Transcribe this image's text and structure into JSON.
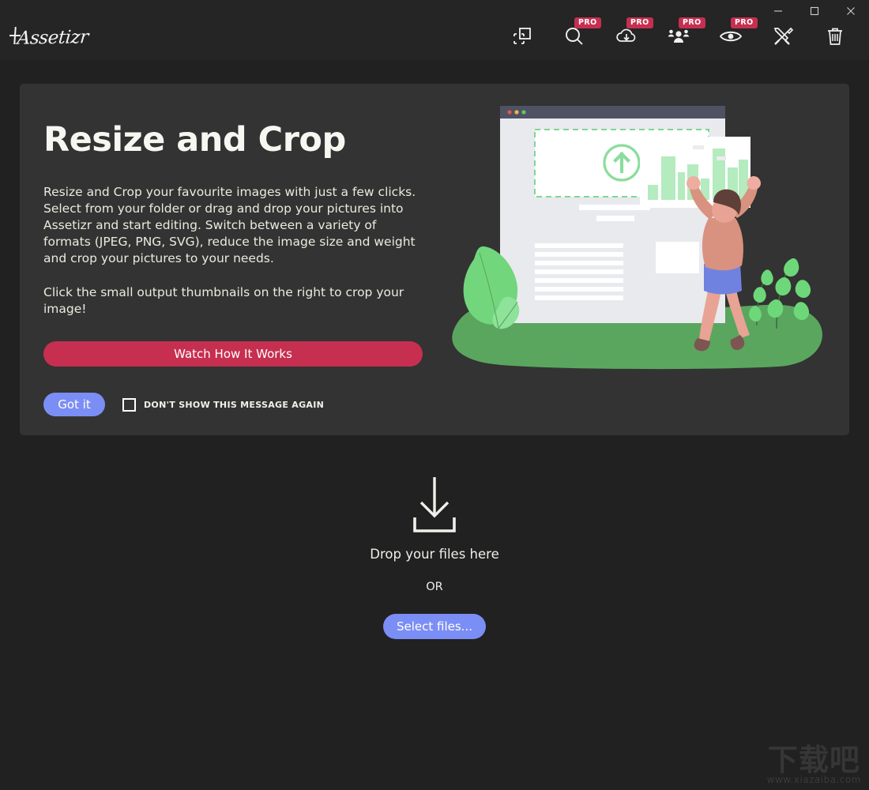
{
  "app": {
    "name": "Assetizr",
    "logo_text": "Assetizr",
    "background_color": "#212121",
    "card_color": "#333333",
    "accent_blue": "#7b8ef5",
    "accent_crimson": "#c62f50"
  },
  "window_controls": [
    {
      "name": "minimize",
      "glyph": "minimize-icon"
    },
    {
      "name": "maximize",
      "glyph": "maximize-icon"
    },
    {
      "name": "close",
      "glyph": "close-icon"
    }
  ],
  "toolbar": {
    "items": [
      {
        "icon": "resize-crop-icon",
        "pro": false,
        "badge": ""
      },
      {
        "icon": "magnifier-icon",
        "pro": true,
        "badge": "PRO"
      },
      {
        "icon": "cloud-download-icon",
        "pro": true,
        "badge": "PRO"
      },
      {
        "icon": "people-group-icon",
        "pro": true,
        "badge": "PRO"
      },
      {
        "icon": "eye-icon",
        "pro": true,
        "badge": "PRO"
      },
      {
        "icon": "tools-icon",
        "pro": false,
        "badge": ""
      },
      {
        "icon": "trash-icon",
        "pro": false,
        "badge": ""
      }
    ]
  },
  "card": {
    "title": "Resize and Crop",
    "paragraph1": "Resize and Crop your favourite images with just a few clicks. Select from your folder or drag and drop your pictures into Assetizr and start editing. Switch between a variety of formats (JPEG, PNG, SVG), reduce the image size and weight and crop your pictures to your needs.",
    "paragraph2": "Click the small output thumbnails on the right to crop your image!",
    "watch_button": "Watch How It Works",
    "got_it_button": "Got it",
    "dont_show_label": "DON'T SHOW THIS MESSAGE AGAIN",
    "dont_show_checked": false
  },
  "dropzone": {
    "icon": "download-tray-icon",
    "drop_text": "Drop your files here",
    "or_text": "OR",
    "select_button": "Select files..."
  },
  "watermark": {
    "cn_text": "下载吧",
    "url_text": "www.xiazaiba.com"
  }
}
